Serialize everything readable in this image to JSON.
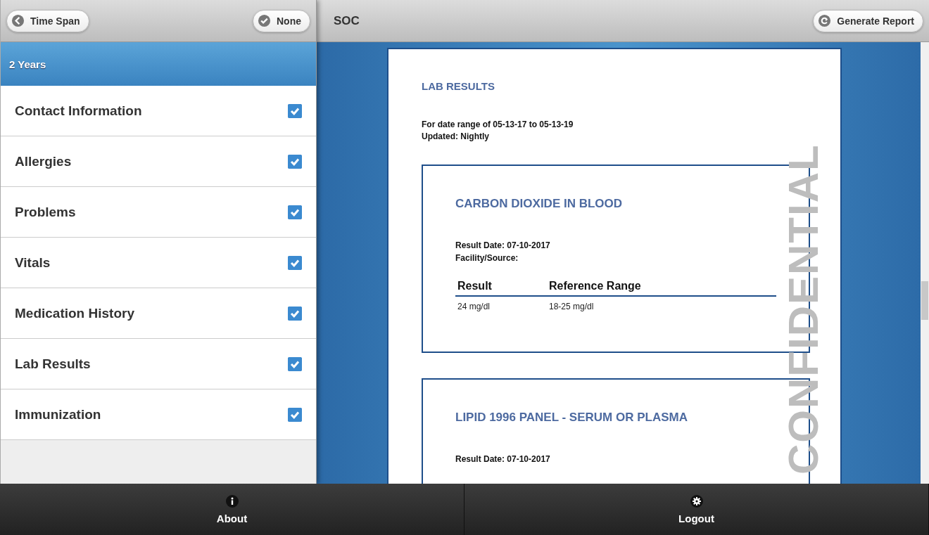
{
  "sidebar": {
    "back_button": "Time Span",
    "none_button": "None",
    "group_header": "2 Years",
    "items": [
      {
        "label": "Contact Information",
        "checked": true
      },
      {
        "label": "Allergies",
        "checked": true
      },
      {
        "label": "Problems",
        "checked": true
      },
      {
        "label": "Vitals",
        "checked": true
      },
      {
        "label": "Medication History",
        "checked": true
      },
      {
        "label": "Lab Results",
        "checked": true
      },
      {
        "label": "Immunization",
        "checked": true
      }
    ]
  },
  "main": {
    "title": "SOC",
    "generate_button": "Generate Report",
    "document": {
      "watermark": "CONFIDENTIAL",
      "heading": "LAB RESULTS",
      "date_range": "For date range of 05-13-17 to 05-13-19",
      "updated": "Updated: Nightly",
      "results": [
        {
          "title": "CARBON DIOXIDE IN BLOOD",
          "result_date": "Result Date: 07-10-2017",
          "facility": "Facility/Source:",
          "columns": [
            "Result",
            "Reference Range"
          ],
          "rows": [
            [
              "24 mg/dl",
              "18-25 mg/dl"
            ]
          ]
        },
        {
          "title": "LIPID 1996 PANEL - SERUM OR PLASMA",
          "result_date": "Result Date: 07-10-2017"
        }
      ]
    }
  },
  "footer": [
    {
      "label": "About",
      "kind": "info"
    },
    {
      "label": "Logout",
      "kind": "settings"
    }
  ]
}
